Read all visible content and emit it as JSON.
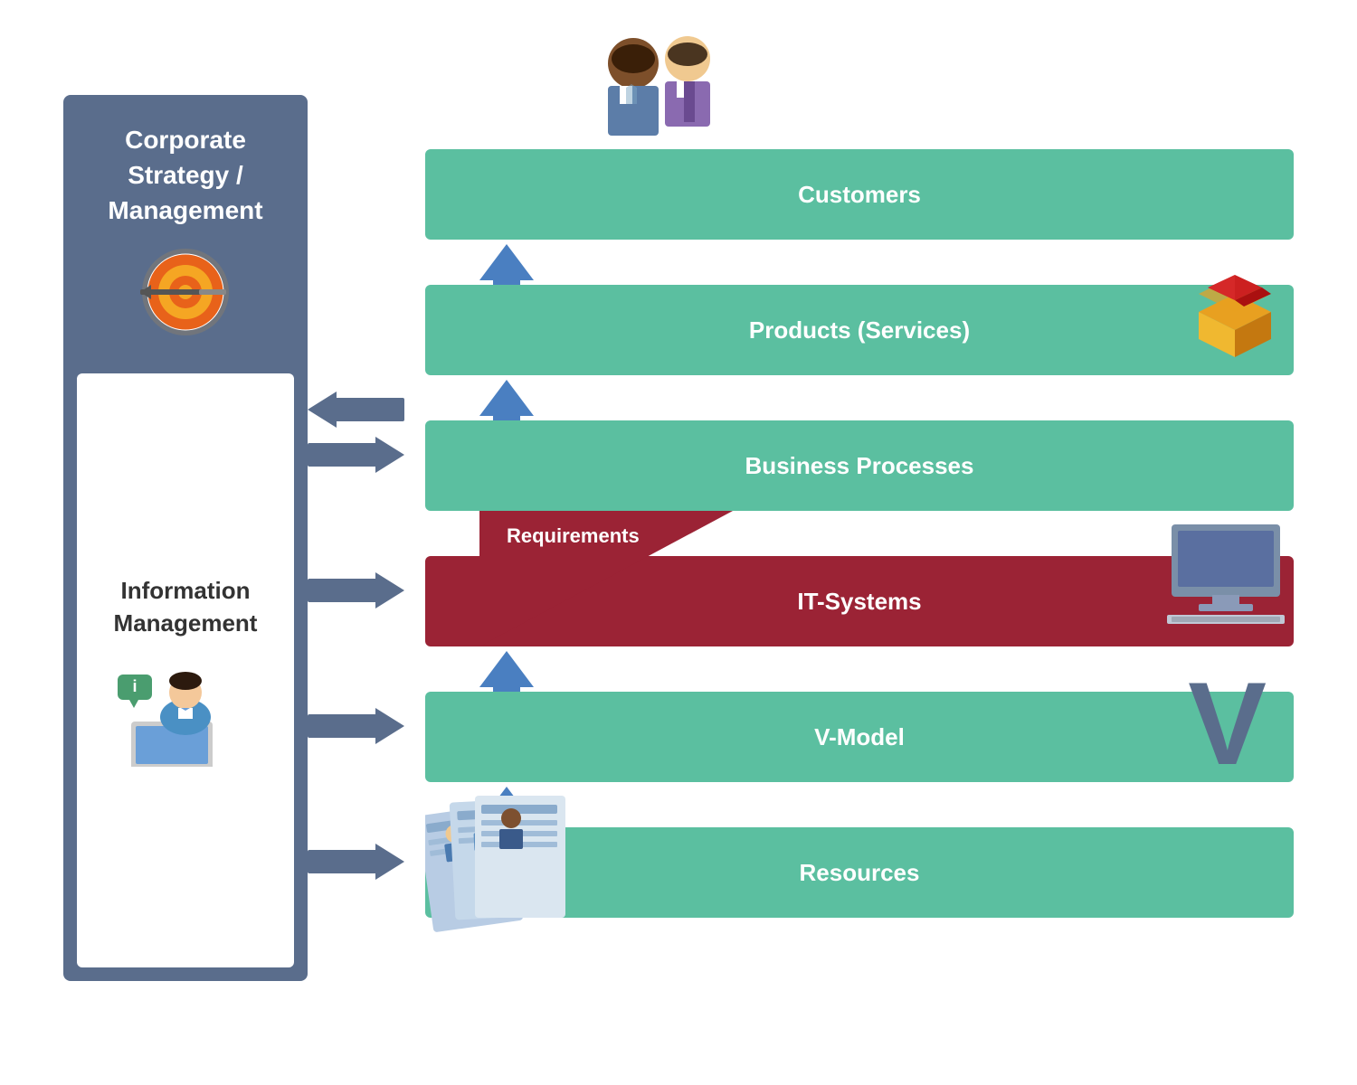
{
  "sidebar": {
    "top_title": "Corporate\nStrategy /\nManagement",
    "bottom_title": "Information\nManagement"
  },
  "layers": {
    "customers": "Customers",
    "products": "Products (Services)",
    "business": "Business Processes",
    "itsystems": "IT-Systems",
    "vmodel": "V-Model",
    "resources": "Resources"
  },
  "labels": {
    "requirements": "Requirements",
    "v_letter": "V"
  }
}
